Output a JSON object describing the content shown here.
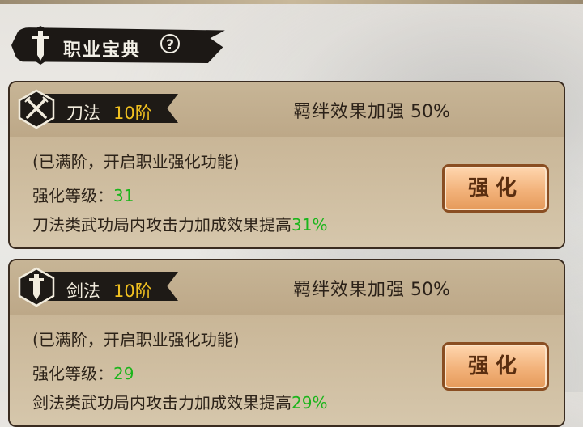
{
  "header": {
    "title": "职业宝典",
    "help_icon": "?"
  },
  "cards": [
    {
      "weapon_name": "刀法",
      "weapon_level": "10阶",
      "weapon_icon": "crossed-sabers-icon",
      "bond_label": "羁绊效果加强",
      "bond_value": "50%",
      "status": "(已满阶，开启职业强化功能)",
      "enhance_label": "强化等级：",
      "enhance_value": "31",
      "bonus_text": "刀法类武功局内攻击力加成效果提高",
      "bonus_value": "31%",
      "button_label": "强化"
    },
    {
      "weapon_name": "剑法",
      "weapon_level": "10阶",
      "weapon_icon": "sword-icon",
      "bond_label": "羁绊效果加强",
      "bond_value": "50%",
      "status": "(已满阶，开启职业强化功能)",
      "enhance_label": "强化等级：",
      "enhance_value": "29",
      "bonus_text": "剑法类武功局内攻击力加成效果提高",
      "bonus_value": "29%",
      "button_label": "强化"
    }
  ],
  "colors": {
    "level_gold": "#f0c020",
    "value_green": "#1bb51b",
    "button_fill": "#f2b27a"
  }
}
